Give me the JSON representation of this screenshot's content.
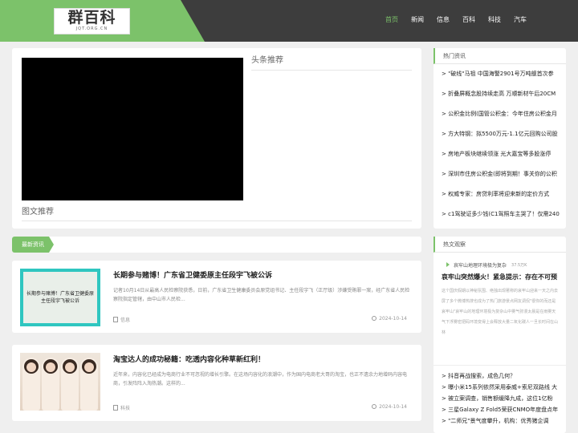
{
  "header": {
    "logo_text": "群百科",
    "logo_sub": "JQT.ORG.CN",
    "nav": [
      "首页",
      "新闻",
      "信息",
      "百科",
      "科技",
      "汽车"
    ]
  },
  "feature": {
    "headline_title": "头条推荐",
    "pic_title": "图文推荐"
  },
  "hot": {
    "title": "热门资讯",
    "items": [
      "> \"破线\"马祖 中国海警2901号万吨舰首次参",
      "> 折叠屏概念股持续走高 万顺新材午后20CM",
      "> 公积金比例(国管公积金：今年住房公积金月",
      "> 方大特钢：拟5500万元-1.1亿元回购公司股",
      "> 房地产板块继续领涨 光大嘉宝等多股涨停",
      "> 深圳市住房公积金(即将到期！事关你的公积",
      "> 权威专家：房贷利率将迎来新的定价方式",
      "> c1驾驶证多少钱(C1驾照车主哭了！仅需240"
    ]
  },
  "news": {
    "tab": "最新资讯",
    "articles": [
      {
        "title": "长期参与赌博！广东省卫健委原主任段宇飞被公诉",
        "summary": "记者10月14日从最高人民检察院获悉，日前，广东省卫生健康委员会原党组书记、主任段宇飞（正厅级）涉嫌受贿罪一案，经广东省人民检察院指定管辖，由中山市人民检...",
        "category": "信息",
        "date": "2024-10-14",
        "thumb_text": "长期参与赌博！广东省卫健委原主任段宇飞被公诉"
      },
      {
        "title": "淘宝达人的成功秘籍：吃透内容化种草新红利！",
        "summary": "近年来，内容化已经成为电商行业不可忽视的增长引擎。在这场内容化的浪潮中，作为国内电商老大哥的淘宝，也正不遗余力地增码内容电商，引发阵阵入淘热潮。这样的...",
        "category": "科技",
        "date": "2024-10-14"
      }
    ]
  },
  "views": {
    "title": "热文观察",
    "video_title": "哀牢山地理环境极为复杂",
    "video_count": "37.5万K",
    "featured_title": "哀牢山突然爆火！紧急提示：存在不可预",
    "featured_summary": "这个国庆假期以神秘氛围、绝独出现著称的哀牢山迎来一天之内去屏了多个微博热搜也成为了热门旅游景点网友调侃\"很你的而还是哀牢山\"哀牢山的地理环境极为复杂山中雾气弥漫太晨是在雨雾天气下浮雾密把码环境变得上会释放大量二氧化碳人一旦长时间在山林",
    "items": [
      "> 抖音再战搜索，成色几何？",
      "> 曝小米15系列依然采用泰威+索尼双路线 大",
      "> 被立案调查，销售额缓降九成，这位1亿粉",
      "> 三星Galaxy Z Fold5荣获CNMO年度盘点年",
      "> \"二师兄\"景气度攀升，机构：优秀猪企调"
    ]
  }
}
